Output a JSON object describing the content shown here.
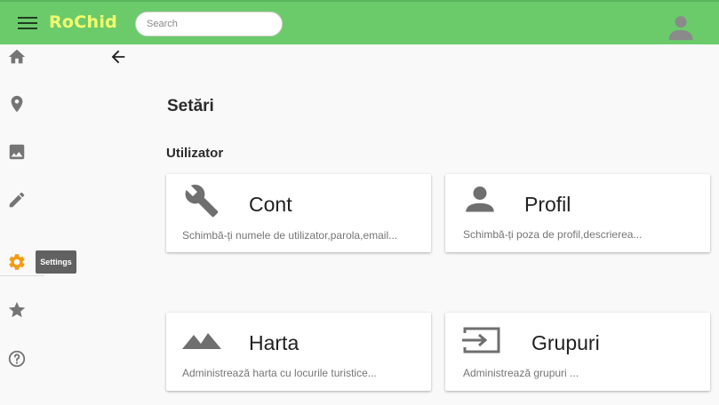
{
  "app": {
    "brand": "RoChid",
    "search": {
      "placeholder": "Search",
      "value": ""
    }
  },
  "sidebar": {
    "items": [
      {
        "icon": "home-icon"
      },
      {
        "icon": "location-pin-icon"
      },
      {
        "icon": "image-icon"
      },
      {
        "icon": "pencil-icon"
      },
      {
        "icon": "settings-gear-icon",
        "active": true,
        "color": "#f39c12"
      },
      {
        "icon": "star-icon"
      },
      {
        "icon": "help-circle-icon"
      }
    ],
    "tooltip": "Settings"
  },
  "page": {
    "title": "Setări",
    "section": "Utilizator"
  },
  "cards": [
    {
      "icon": "wrench-icon",
      "title": "Cont",
      "description": "Schimbă-ți numele de utilizator,parola,email..."
    },
    {
      "icon": "person-icon",
      "title": "Profil",
      "description": "Schimbă-ți poza de profil,descrierea..."
    },
    {
      "icon": "mountains-icon",
      "title": "Harta",
      "description": "Administrează harta cu locurile turistice..."
    },
    {
      "icon": "group-input-icon",
      "title": "Grupuri",
      "description": "Administrează grupuri ..."
    }
  ],
  "colors": {
    "topbar": "#6bcb6b",
    "brand": "#f4ff6e",
    "accent": "#f39c12",
    "icon_gray": "#757575"
  }
}
